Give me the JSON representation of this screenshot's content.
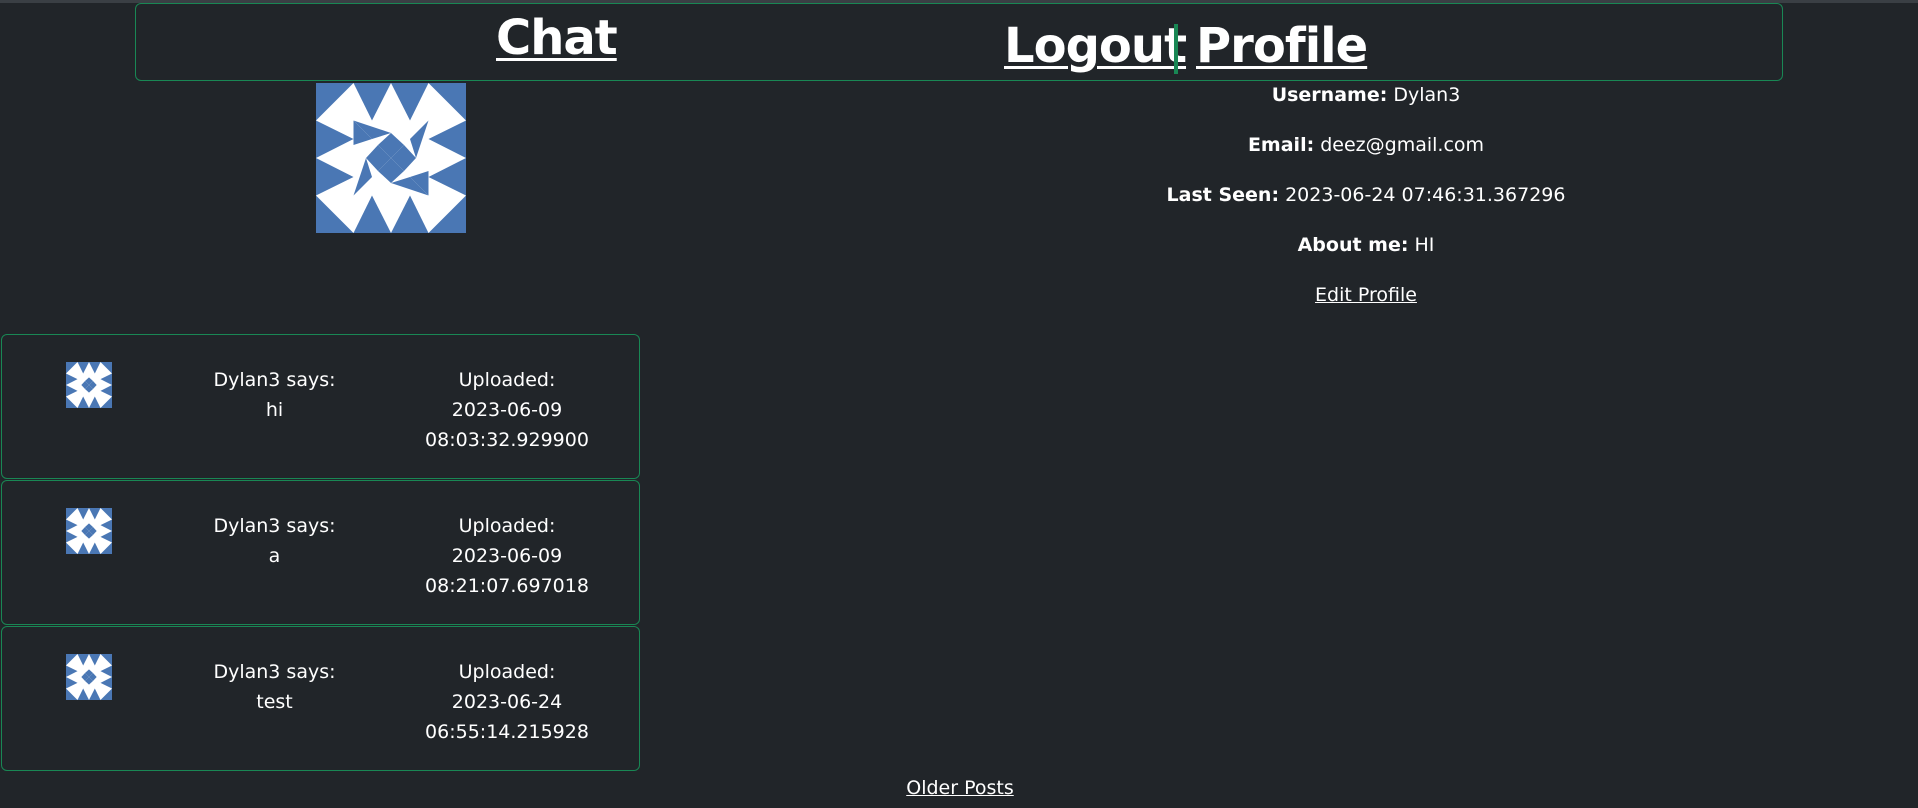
{
  "nav": {
    "chat_label": "Chat",
    "logout_label": "Logout",
    "profile_label": "Profile"
  },
  "profile": {
    "username_label": "Username:",
    "username": "Dylan3",
    "email_label": "Email:",
    "email": "deez@gmail.com",
    "last_seen_label": "Last Seen:",
    "last_seen": "2023-06-24 07:46:31.367296",
    "about_label": "About me:",
    "about": "HI",
    "edit_label": "Edit Profile"
  },
  "posts": [
    {
      "author": "Dylan3 says:",
      "body": "hi",
      "uploaded_label": "Uploaded:",
      "date": "2023-06-09",
      "time": "08:03:32.929900"
    },
    {
      "author": "Dylan3 says:",
      "body": "a",
      "uploaded_label": "Uploaded:",
      "date": "2023-06-09",
      "time": "08:21:07.697018"
    },
    {
      "author": "Dylan3 says:",
      "body": "test",
      "uploaded_label": "Uploaded:",
      "date": "2023-06-24",
      "time": "06:55:14.215928"
    }
  ],
  "older_posts_label": "Older Posts",
  "colors": {
    "background": "#212529",
    "accent": "#198754",
    "identicon": "#4a77b4"
  },
  "icons": {
    "avatar": "identicon-avatar-icon"
  }
}
